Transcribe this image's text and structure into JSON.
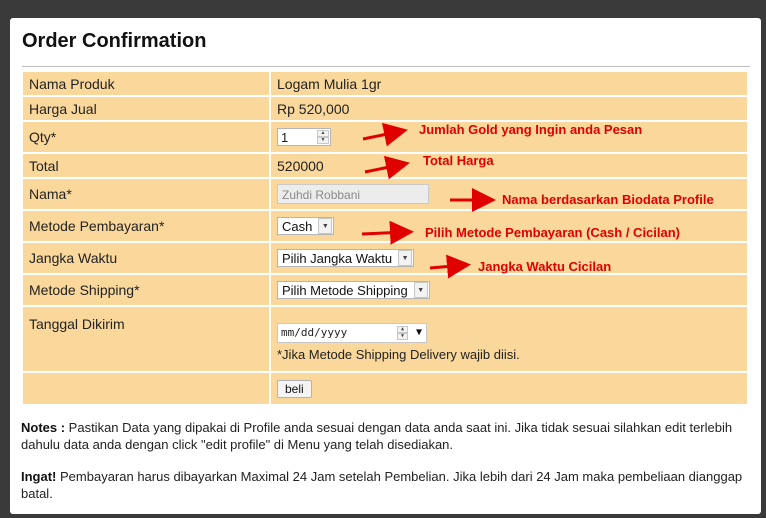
{
  "page": {
    "title": "Order Confirmation"
  },
  "form": {
    "rows": [
      {
        "label": "Nama Produk",
        "value": "Logam Mulia 1gr"
      },
      {
        "label": "Harga Jual",
        "value": "Rp 520,000"
      },
      {
        "label": "Qty*",
        "value": "1"
      },
      {
        "label": "Total",
        "value": "520000"
      },
      {
        "label": "Nama*",
        "value": "Zuhdi Robbani"
      },
      {
        "label": "Metode Pembayaran*",
        "value": "Cash"
      },
      {
        "label": "Jangka Waktu",
        "value": "Pilih Jangka Waktu"
      },
      {
        "label": "Metode Shipping*",
        "value": "Pilih Metode Shipping"
      },
      {
        "label": "Tanggal Dikirim",
        "value": "mm/dd/yyyy",
        "hint": "*Jika Metode Shipping Delivery wajib diisi."
      }
    ],
    "submit_label": "beli"
  },
  "annotations": {
    "qty": "Jumlah Gold yang Ingin anda Pesan",
    "total": "Total Harga",
    "nama": "Nama berdasarkan Biodata Profile",
    "metode": "Pilih Metode Pembayaran (Cash / Cicilan)",
    "jangka": "Jangka Waktu Cicilan"
  },
  "notes": {
    "notes_label": "Notes :",
    "notes_text": " Pastikan Data yang dipakai di Profile anda sesuai dengan data anda saat ini. Jika tidak sesuai silahkan edit terlebih dahulu data anda dengan click \"edit profile\" di Menu yang telah disediakan.",
    "ingat_label": "Ingat!",
    "ingat_text": " Pembayaran harus dibayarkan Maximal 24 Jam setelah Pembelian. Jika lebih dari 24 Jam maka pembeliaan dianggap batal."
  },
  "colors": {
    "row_bg": "#fad79a",
    "annotation": "#e00000",
    "outer_bg": "#3a3a3a"
  }
}
